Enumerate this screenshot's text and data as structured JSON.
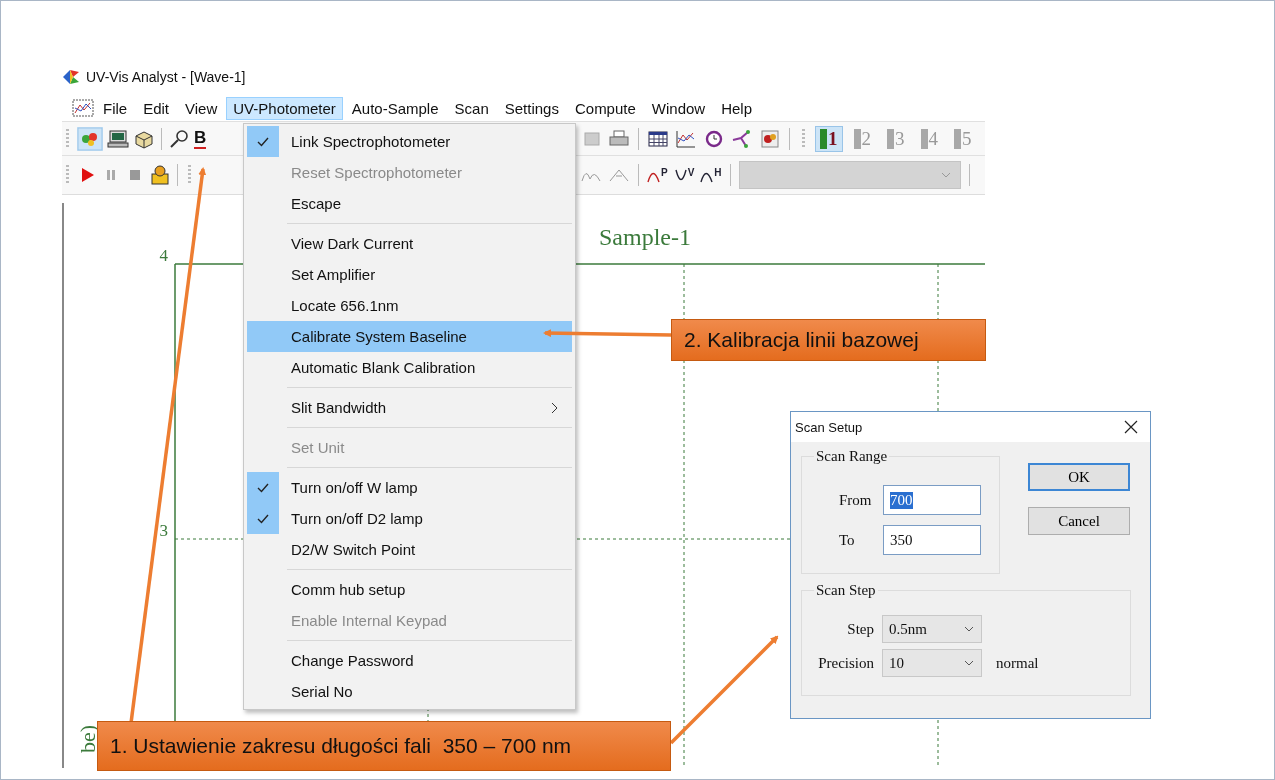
{
  "window": {
    "title": "UV-Vis Analyst - [Wave-1]"
  },
  "menu_bar": {
    "items": [
      {
        "label": "File",
        "selected": false
      },
      {
        "label": "Edit",
        "selected": false
      },
      {
        "label": "View",
        "selected": false
      },
      {
        "label": "UV-Photometer",
        "selected": true
      },
      {
        "label": "Auto-Sample",
        "selected": false
      },
      {
        "label": "Scan",
        "selected": false
      },
      {
        "label": "Settings",
        "selected": false
      },
      {
        "label": "Compute",
        "selected": false
      },
      {
        "label": "Window",
        "selected": false
      },
      {
        "label": "Help",
        "selected": false
      }
    ]
  },
  "toolbar": {
    "format_button": "B",
    "peak_tools": [
      "P",
      "V",
      "H"
    ],
    "panes": [
      {
        "label": "1",
        "selected": true
      },
      {
        "label": "2",
        "selected": false
      },
      {
        "label": "3",
        "selected": false
      },
      {
        "label": "4",
        "selected": false
      },
      {
        "label": "5",
        "selected": false
      }
    ]
  },
  "plot": {
    "title": "Sample-1",
    "y_ticks": [
      "4",
      "3"
    ],
    "y_axis_label": "be)"
  },
  "menu": {
    "groups": [
      {
        "items": [
          {
            "label": "Link Spectrophotometer",
            "checked": true,
            "disabled": false,
            "selected": false,
            "submenu": false
          },
          {
            "label": "Reset Spectrophotometer",
            "checked": false,
            "disabled": true,
            "selected": false,
            "submenu": false
          },
          {
            "label": "Escape",
            "checked": false,
            "disabled": false,
            "selected": false,
            "submenu": false
          }
        ]
      },
      {
        "items": [
          {
            "label": "View Dark Current",
            "checked": false,
            "disabled": false,
            "selected": false,
            "submenu": false
          },
          {
            "label": "Set Amplifier",
            "checked": false,
            "disabled": false,
            "selected": false,
            "submenu": false
          },
          {
            "label": "Locate 656.1nm",
            "checked": false,
            "disabled": false,
            "selected": false,
            "submenu": false
          },
          {
            "label": "Calibrate System Baseline",
            "checked": false,
            "disabled": false,
            "selected": true,
            "submenu": false
          },
          {
            "label": "Automatic Blank Calibration",
            "checked": false,
            "disabled": false,
            "selected": false,
            "submenu": false
          }
        ]
      },
      {
        "items": [
          {
            "label": "Slit Bandwidth",
            "checked": false,
            "disabled": false,
            "selected": false,
            "submenu": true
          }
        ]
      },
      {
        "items": [
          {
            "label": "Set Unit",
            "checked": false,
            "disabled": true,
            "selected": false,
            "submenu": false
          }
        ]
      },
      {
        "items": [
          {
            "label": "Turn on/off W lamp",
            "checked": true,
            "disabled": false,
            "selected": false,
            "submenu": false
          },
          {
            "label": "Turn on/off D2 lamp",
            "checked": true,
            "disabled": false,
            "selected": false,
            "submenu": false
          },
          {
            "label": "D2/W Switch Point",
            "checked": false,
            "disabled": false,
            "selected": false,
            "submenu": false
          }
        ]
      },
      {
        "items": [
          {
            "label": "Comm hub setup",
            "checked": false,
            "disabled": false,
            "selected": false,
            "submenu": false
          },
          {
            "label": "Enable Internal Keypad",
            "checked": false,
            "disabled": true,
            "selected": false,
            "submenu": false
          }
        ]
      },
      {
        "items": [
          {
            "label": "Change Password",
            "checked": false,
            "disabled": false,
            "selected": false,
            "submenu": false
          },
          {
            "label": "Serial No",
            "checked": false,
            "disabled": false,
            "selected": false,
            "submenu": false
          }
        ]
      }
    ]
  },
  "dialog": {
    "title": "Scan Setup",
    "range_group": {
      "title": "Scan Range",
      "fields": [
        {
          "label": "From",
          "value": "700",
          "text_selected": true
        },
        {
          "label": "To",
          "value": "350",
          "text_selected": false
        }
      ]
    },
    "buttons": [
      {
        "label": "OK",
        "default": true
      },
      {
        "label": "Cancel",
        "default": false
      }
    ],
    "step_group": {
      "title": "Scan Step",
      "selects": [
        {
          "label": "Step",
          "value": "0.5nm"
        },
        {
          "label": "Precision",
          "value": "10",
          "note": "normal"
        }
      ]
    }
  },
  "callouts": [
    {
      "text": "2. Kalibracja linii bazowej"
    },
    {
      "text": "1. Ustawienie zakresu długości fali  350 – 700 nm"
    }
  ]
}
